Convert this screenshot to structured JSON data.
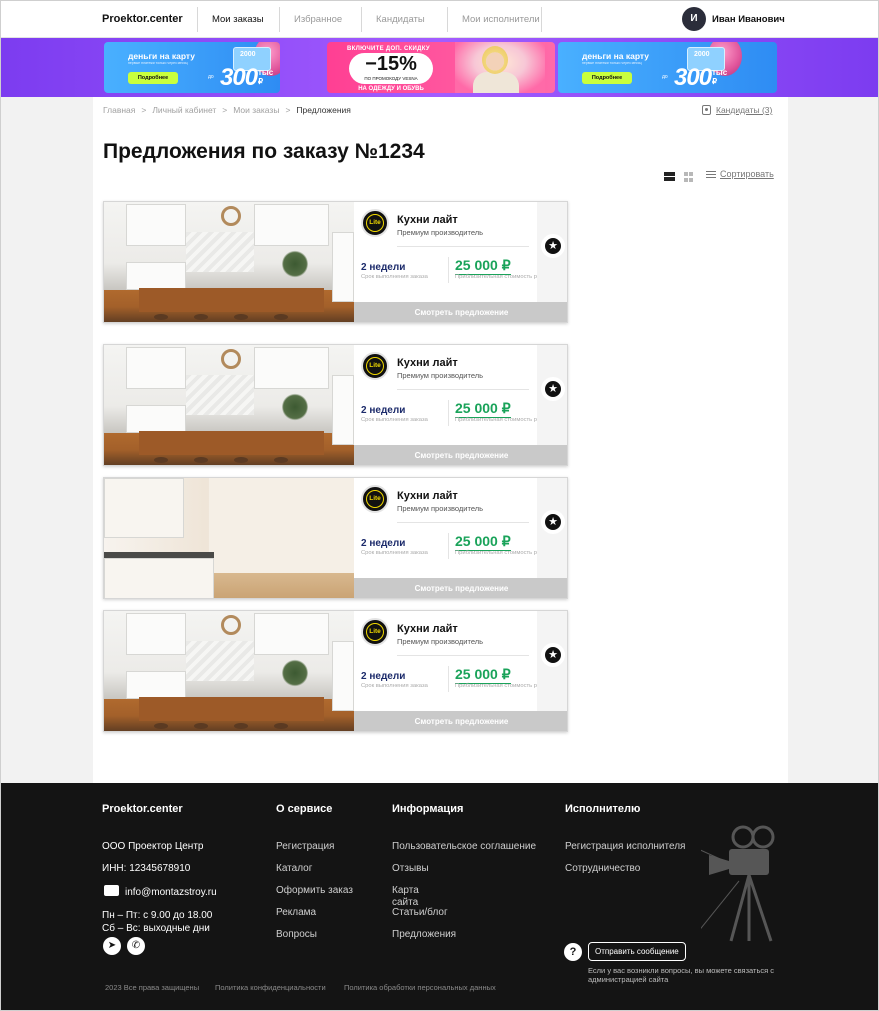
{
  "header": {
    "logo": "Proektor.center",
    "nav": [
      "Мои заказы",
      "Избранное",
      "Кандидаты",
      "Мои исполнители"
    ],
    "user_initial": "И",
    "user_name": "Иван Иванович"
  },
  "promo": {
    "card_ad": {
      "title": "деньги на карту",
      "subtitle": "первые платежи только через месяц",
      "button": "Подробнее",
      "card_value": "2000",
      "prefix": "до",
      "amount": "300",
      "amount_unit_1": "тыс",
      "amount_unit_2": "₽"
    },
    "discount_ad": {
      "top": "ВКЛЮЧИТЕ ДОП. СКИДКУ",
      "percent": "−15%",
      "code": "ПО ПРОМОКОДУ VESNA",
      "bottom": "НА ОДЕЖДУ И ОБУВЬ"
    }
  },
  "breadcrumb": {
    "items": [
      "Главная",
      "Личный кабинет",
      "Мои заказы"
    ],
    "current": "Предложения",
    "sep": ">"
  },
  "candidates_link": "Кандидаты (3)",
  "page_title": "Предложения по заказу №1234",
  "sort_label": "Сортировать",
  "offers": [
    {
      "company": "Кухни лайт",
      "type": "Премиум производитель",
      "logo_text": "Lite",
      "term": "2 недели",
      "term_label": "Срок выполнения заказа",
      "price": "25 000 ₽",
      "price_label": "Приблизительная стоимость работ",
      "button": "Смотреть предложение"
    },
    {
      "company": "Кухни лайт",
      "type": "Премиум производитель",
      "logo_text": "Lite",
      "term": "2 недели",
      "term_label": "Срок выполнения заказа",
      "price": "25 000 ₽",
      "price_label": "Приблизительная стоимость работ",
      "button": "Смотреть предложение"
    },
    {
      "company": "Кухни лайт",
      "type": "Премиум производитель",
      "logo_text": "Lite",
      "term": "2 недели",
      "term_label": "Срок выполнения заказа",
      "price": "25 000 ₽",
      "price_label": "Приблизительная стоимость работ",
      "button": "Смотреть предложение"
    },
    {
      "company": "Кухни лайт",
      "type": "Премиум производитель",
      "logo_text": "Lite",
      "term": "2 недели",
      "term_label": "Срок выполнения заказа",
      "price": "25 000 ₽",
      "price_label": "Приблизительная стоимость работ",
      "button": "Смотреть предложение"
    }
  ],
  "footer": {
    "logo": "Proektor.center",
    "company": "ООО Проектор Центр",
    "inn": "ИНН: 12345678910",
    "email": "info@montazstroy.ru",
    "hours_1": "Пн – Пт: с 9.00 до 18.00",
    "hours_2": "Сб – Вс: выходные дни",
    "col_about": {
      "title": "О сервисе",
      "links": [
        "Регистрация",
        "Каталог",
        "Оформить заказ",
        "Реклама",
        "Вопросы"
      ]
    },
    "col_info": {
      "title": "Информация",
      "links": [
        "Пользовательское соглашение",
        "Отзывы",
        "Карта сайта",
        "Статьи/блог",
        "Предложения"
      ]
    },
    "col_exec": {
      "title": "Исполнителю",
      "links": [
        "Регистрация исполнителя",
        "Сотрудничество"
      ]
    },
    "help_icon": "?",
    "message_button": "Отправить сообщение",
    "help_note": "Если у вас возникли вопросы, вы можете связаться с администрацией сайта",
    "copyright": "2023 Все права защищены",
    "privacy": "Политика конфиденциальности",
    "personal_data": "Политика обработки персональных данных"
  },
  "icons": {
    "star": "★",
    "telegram": "➤",
    "whatsapp": "✆"
  },
  "colors": {
    "accent_green": "#1aa35a",
    "dark_blue": "#1c2b6b",
    "promo_purple": "#7c3cf0",
    "footer_bg": "#141414"
  }
}
